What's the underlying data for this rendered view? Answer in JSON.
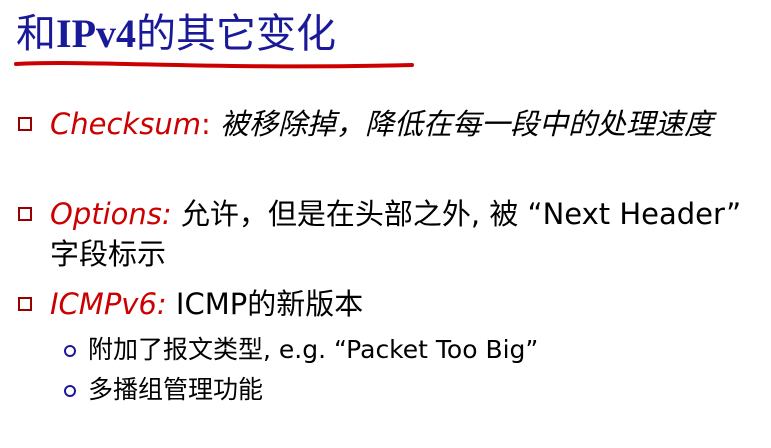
{
  "title": {
    "prefix": "和",
    "latin": "IPv4",
    "suffix": "的其它变化"
  },
  "bullets": [
    {
      "label": "Checksum",
      "label_suffix": ":",
      "text": " 被移除掉，降低在每一段中的处理速度"
    },
    {
      "label": "Options:",
      "text": " 允许，但是在头部之外, 被 “Next Header” 字段标示"
    },
    {
      "label": "ICMPv6:",
      "text": " ICMP的新版本"
    }
  ],
  "sub_bullets": [
    {
      "text": "附加了报文类型, e.g. “Packet Too Big”"
    },
    {
      "text": "多播组管理功能"
    }
  ],
  "colors": {
    "title": "#1a1a99",
    "accent_red": "#cc0000",
    "underline": "#cc0000",
    "bullet_square": "#990000",
    "sub_bullet_circle": "#1a1a99"
  }
}
